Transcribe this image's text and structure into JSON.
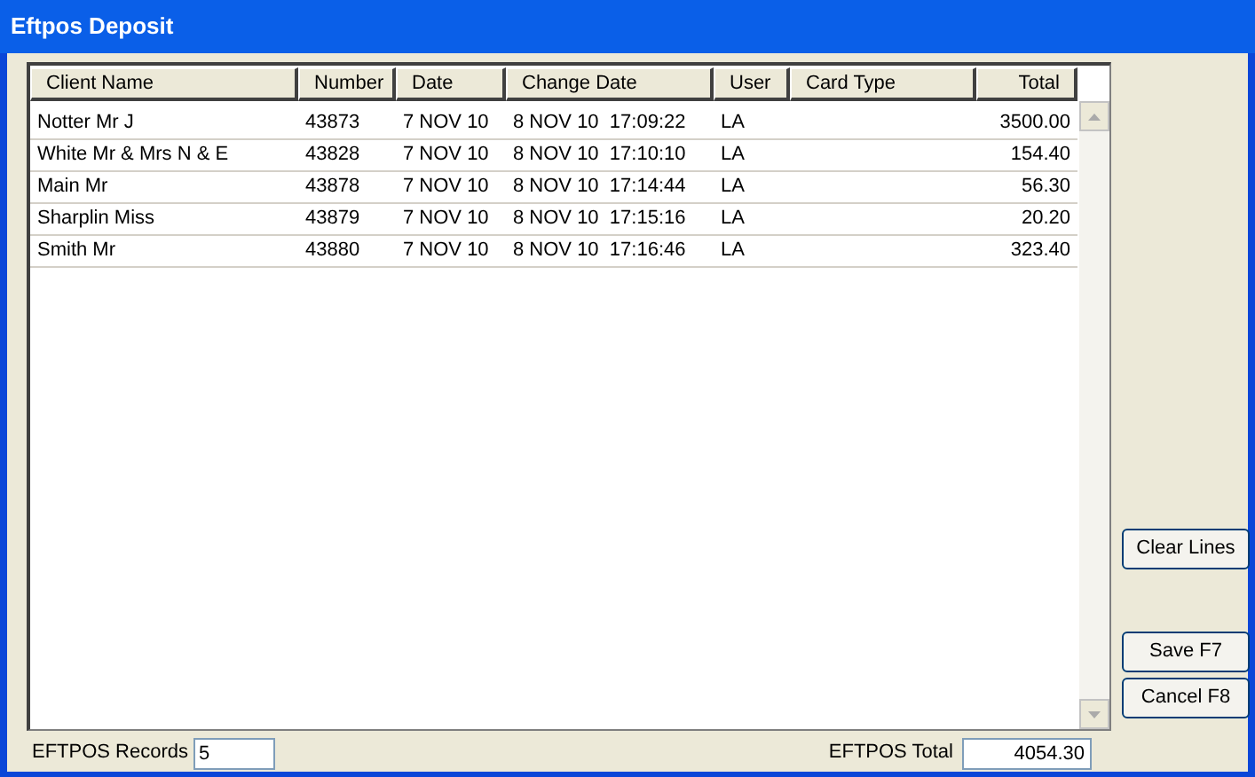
{
  "window": {
    "title": "Eftpos Deposit"
  },
  "table": {
    "columns": [
      "Client Name",
      "Number",
      "Date",
      "Change Date",
      "User",
      "Card Type",
      "Total"
    ],
    "rows": [
      {
        "cells": [
          "Notter Mr J",
          "43873",
          "7 NOV 10",
          "8 NOV 10  17:09:22",
          "LA",
          null,
          "3500.00"
        ]
      },
      {
        "cells": [
          "White Mr & Mrs N & E",
          "43828",
          "7 NOV 10",
          "8 NOV 10  17:10:10",
          "LA",
          null,
          "154.40"
        ]
      },
      {
        "cells": [
          "Main Mr",
          "43878",
          "7 NOV 10",
          "8 NOV 10  17:14:44",
          "LA",
          null,
          "56.30"
        ]
      },
      {
        "cells": [
          "Sharplin Miss",
          "43879",
          "7 NOV 10",
          "8 NOV 10  17:15:16",
          "LA",
          null,
          "20.20"
        ]
      },
      {
        "cells": [
          "Smith Mr",
          "43880",
          "7 NOV 10",
          "8 NOV 10  17:16:46",
          "LA",
          null,
          "323.40"
        ]
      }
    ]
  },
  "footer": {
    "records_label": "EFTPOS Records",
    "records_value": "5",
    "total_label": "EFTPOS Total",
    "total_value": "4054.30"
  },
  "clear_button": "Clear Lines",
  "dialog_buttons": [
    "Save F7",
    "Cancel F8"
  ]
}
